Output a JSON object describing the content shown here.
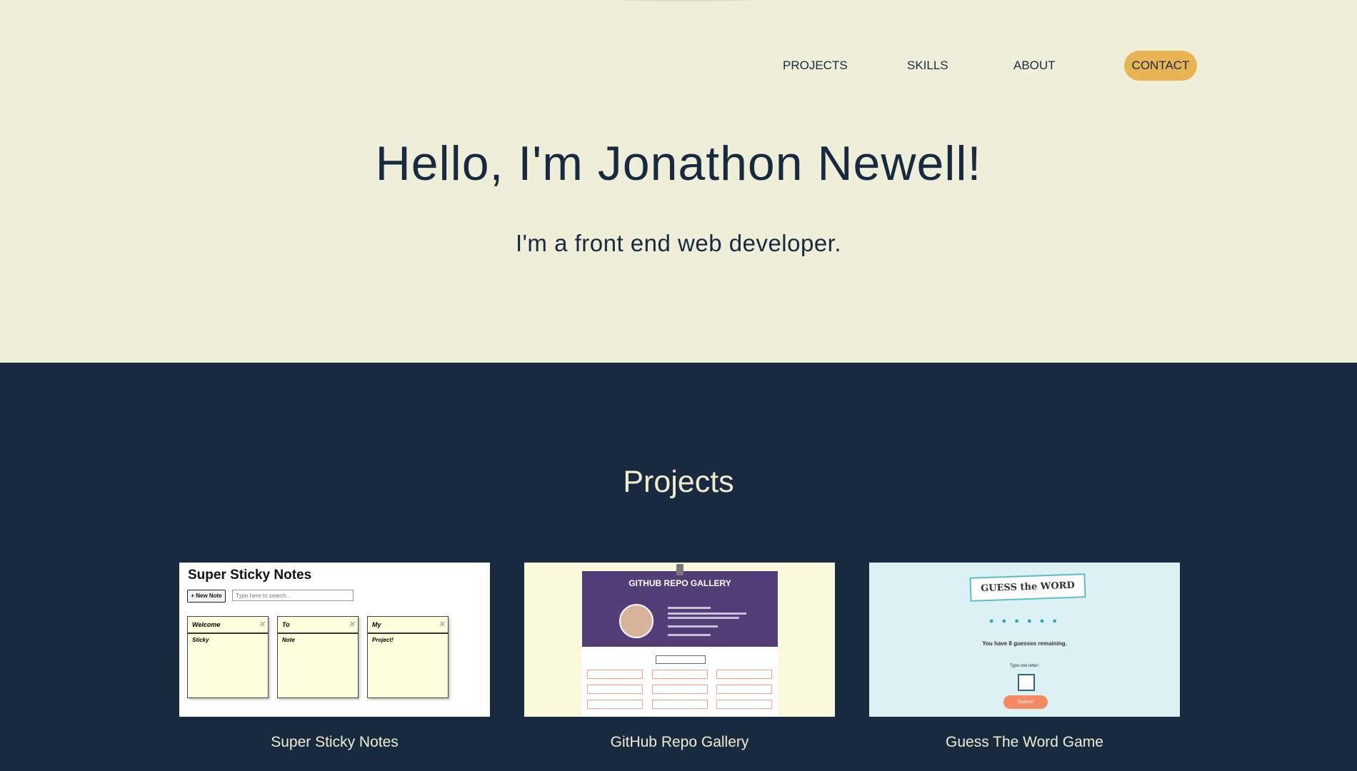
{
  "colors": {
    "hero_bg": "#eeeed9",
    "navy": "#182a40",
    "contact_bg": "#e9b454",
    "cream_text": "#f1eccd"
  },
  "nav": {
    "items": [
      {
        "label": "PROJECTS"
      },
      {
        "label": "SKILLS"
      },
      {
        "label": "ABOUT"
      }
    ],
    "contact": "CONTACT"
  },
  "hero": {
    "title": "Hello, I'm Jonathon Newell!",
    "subtitle": "I'm a front end web developer."
  },
  "projects": {
    "heading": "Projects",
    "cards": [
      {
        "title": "Super Sticky Notes",
        "preview": {
          "app_title": "Super Sticky Notes",
          "new_note": "+ New Note",
          "search_placeholder": "Type here to search...",
          "notes": [
            {
              "title": "Welcome",
              "body": "Sticky"
            },
            {
              "title": "To",
              "body": "Note"
            },
            {
              "title": "My",
              "body": "Project!"
            }
          ]
        }
      },
      {
        "title": "GitHub Repo Gallery",
        "preview": {
          "app_title": "GITHUB REPO GALLERY"
        }
      },
      {
        "title": "Guess The Word Game",
        "preview": {
          "app_title": "GUESS the WORD",
          "dots": "● ● ● ● ● ●",
          "message": "You have 8 guesses remaining.",
          "input_label": "Type one letter:",
          "button": "Guess!"
        }
      }
    ]
  }
}
